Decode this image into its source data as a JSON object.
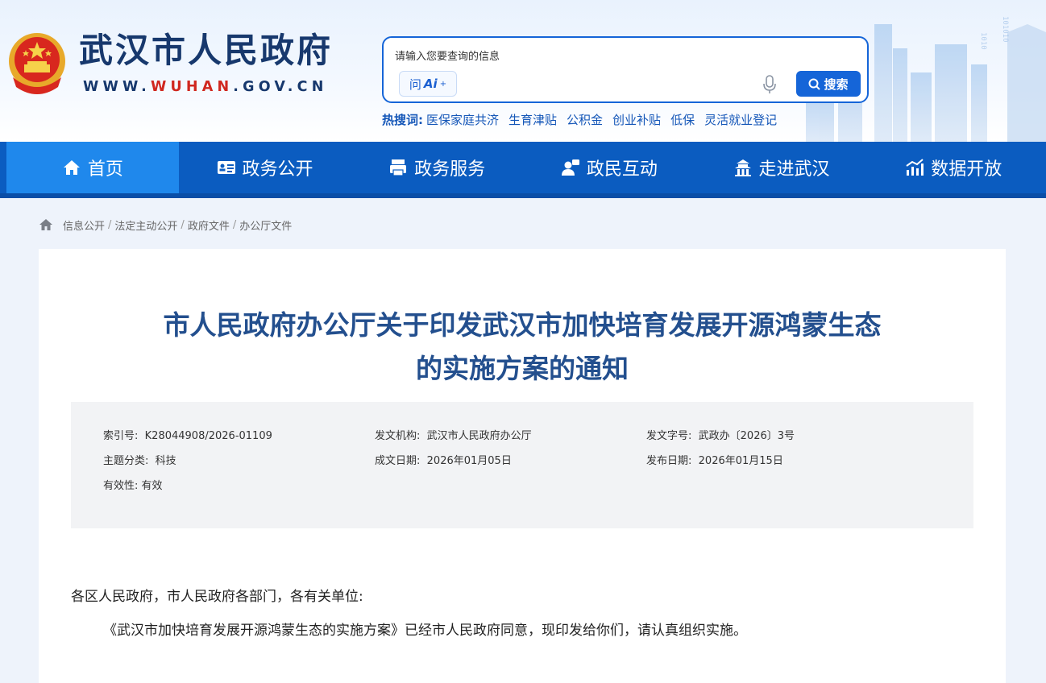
{
  "header": {
    "site_title": "武汉市人民政府",
    "url_prefix": "WWW.",
    "url_brand": "WUHAN",
    "url_suffix": ".GOV.CN",
    "brand_color": "#17386d",
    "accent_color": "#1565d8"
  },
  "search": {
    "placeholder": "请输入您要查询的信息",
    "ai_label": "问",
    "ai_brand": "Ai",
    "ai_sup": "+",
    "button_label": "搜索",
    "hot_label": "热搜词:",
    "hot_terms": [
      "医保家庭共济",
      "生育津贴",
      "公积金",
      "创业补贴",
      "低保",
      "灵活就业登记"
    ]
  },
  "nav": {
    "items": [
      {
        "label": "首页",
        "icon": "home-icon"
      },
      {
        "label": "政务公开",
        "icon": "id-card-icon"
      },
      {
        "label": "政务服务",
        "icon": "printer-icon"
      },
      {
        "label": "政民互动",
        "icon": "user-chat-icon"
      },
      {
        "label": "走进武汉",
        "icon": "pavilion-icon"
      },
      {
        "label": "数据开放",
        "icon": "chart-icon"
      }
    ],
    "active_index": 0
  },
  "breadcrumb": [
    "信息公开",
    "法定主动公开",
    "政府文件",
    "办公厅文件"
  ],
  "article": {
    "title_line1": "市人民政府办公厅关于印发武汉市加快培育发展开源鸿蒙生态",
    "title_line2": "的实施方案的通知",
    "meta": {
      "index_label": "索引号:",
      "index_value": "K28044908/2026-01109",
      "org_label": "发文机构:",
      "org_value": "武汉市人民政府办公厅",
      "doc_no_label": "发文字号:",
      "doc_no_value": "武政办〔2026〕3号",
      "topic_label": "主题分类:",
      "topic_value": "科技",
      "created_label": "成文日期:",
      "created_value": "2026年01月05日",
      "published_label": "发布日期:",
      "published_value": "2026年01月15日",
      "validity_label": "有效性:",
      "validity_value": "有效"
    },
    "salutation": "各区人民政府，市人民政府各部门，各有关单位:",
    "paragraph1": "《武汉市加快培育发展开源鸿蒙生态的实施方案》已经市人民政府同意，现印发给你们，请认真组织实施。"
  }
}
